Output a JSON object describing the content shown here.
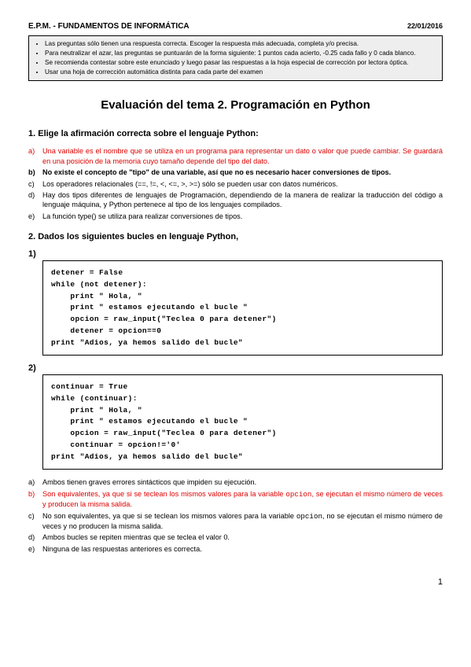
{
  "header": {
    "left": "E.P.M. - FUNDAMENTOS DE INFORMÁTICA",
    "right": "22/01/2016"
  },
  "instructions": [
    "Las preguntas sólo tienen una respuesta correcta. Escoger la respuesta más adecuada, completa y/o precisa.",
    "Para neutralizar el azar, las preguntas se puntuarán de la forma siguiente: 1 puntos cada acierto, -0.25 cada fallo y 0 cada blanco.",
    "Se recomienda contestar sobre este enunciado y luego pasar las respuestas a la hoja especial de corrección por lectora óptica.",
    "Usar una hoja de corrección automática distinta para cada parte del examen"
  ],
  "title": "Evaluación del tema 2. Programación en Python",
  "q1": {
    "head": "1.  Elige la afirmación correcta sobre el lenguaje Python:",
    "opts": [
      {
        "l": "a)",
        "t": "Una variable es el nombre que se utiliza en un programa para representar un dato o valor que puede cambiar. Se guardará en una posición de la memoria cuyo tamaño depende del tipo del dato.",
        "red": true
      },
      {
        "l": "b)",
        "t": "No existe el concepto de \"tipo\" de una variable, así que no es necesario hacer conversiones de tipos.",
        "bold": true
      },
      {
        "l": "c)",
        "t": "Los operadores relacionales (==, !=, <, <=, >, >=) sólo se pueden usar con datos numéricos."
      },
      {
        "l": "d)",
        "t": "Hay dos tipos diferentes de lenguajes de Programación, dependiendo de la manera de realizar la traducción del código a lenguaje máquina, y Python pertenece al tipo de los lenguajes compilados."
      },
      {
        "l": "e)",
        "t": "La función type() se utiliza para realizar conversiones de tipos."
      }
    ]
  },
  "q2": {
    "head": "2.  Dados los siguientes bucles en lenguaje Python,",
    "sub1": "1)",
    "code1": "detener = False\nwhile (not detener):\n    print \" Hola, \"\n    print \" estamos ejecutando el bucle \"\n    opcion = raw_input(\"Teclea 0 para detener\")\n    detener = opcion==0\nprint \"Adios, ya hemos salido del bucle\"",
    "sub2": "2)",
    "code2": "continuar = True\nwhile (continuar):\n    print \" Hola, \"\n    print \" estamos ejecutando el bucle \"\n    opcion = raw_input(\"Teclea 0 para detener\")\n    continuar = opcion!='0'\nprint \"Adios, ya hemos salido del bucle\"",
    "opts": [
      {
        "l": "a)",
        "t": "Ambos tienen graves errores sintácticos que impiden su ejecución."
      },
      {
        "l": "b)",
        "pre": "Son equivalentes, ya que si se teclean los mismos valores para la variable ",
        "var": "opcion",
        "post": ", se ejecutan el mismo número de veces y producen la misma salida.",
        "red": true
      },
      {
        "l": "c)",
        "pre": "No son equivalentes, ya que si se teclean los mismos valores para la variable ",
        "var": "opcion",
        "post": ", no se ejecutan el mismo número de veces y no producen la misma salida."
      },
      {
        "l": "d)",
        "t": "Ambos bucles se repiten mientras que se teclea el valor 0."
      },
      {
        "l": "e)",
        "t": "Ninguna de las respuestas anteriores es correcta."
      }
    ]
  },
  "pagenum": "1"
}
